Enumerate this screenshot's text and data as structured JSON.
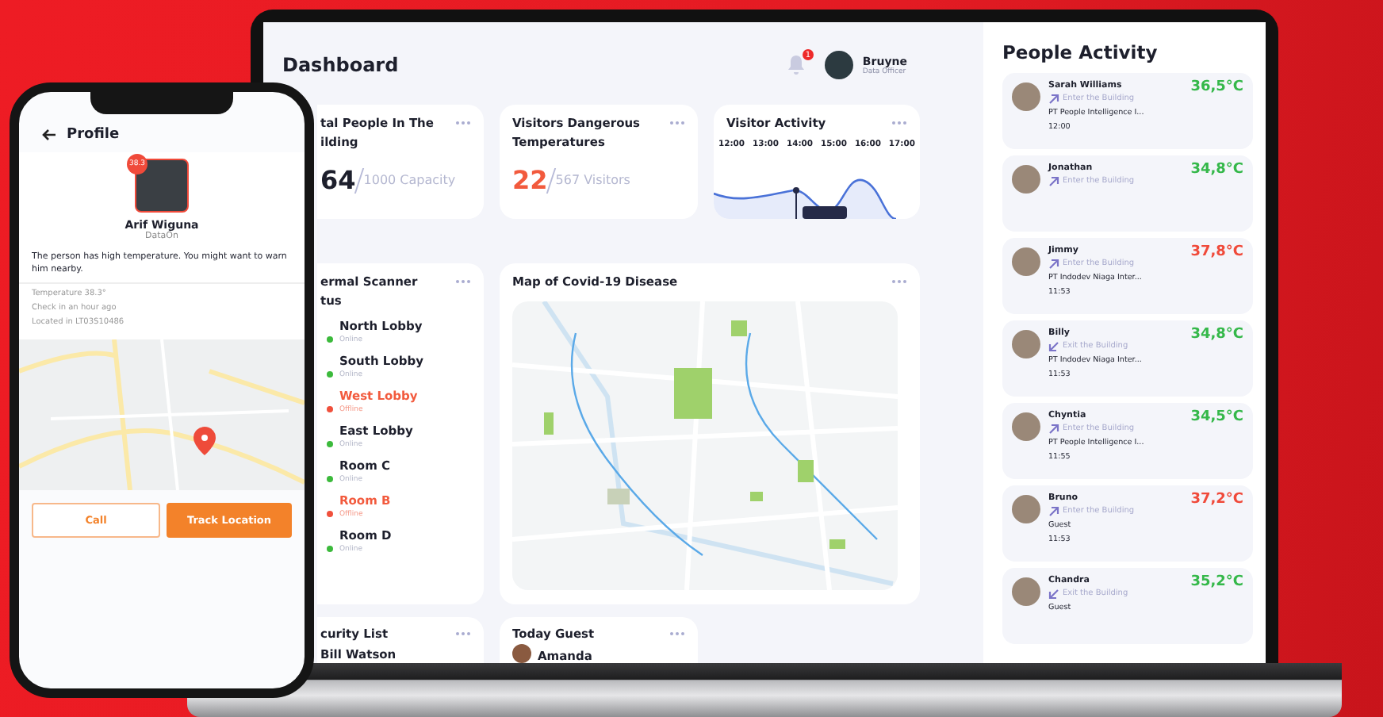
{
  "dashboard": {
    "title": "Dashboard",
    "user": {
      "name": "Bruyne",
      "role": "Data Officer",
      "notifications": "1"
    },
    "stats": [
      {
        "title_lines": [
          "tal People In The",
          "ilding"
        ],
        "value": "64",
        "total": "1000 Capacity",
        "alert": false
      },
      {
        "title_lines": [
          "Visitors Dangerous",
          "Temperatures"
        ],
        "value": "22",
        "total": "567 Visitors",
        "alert": true
      }
    ],
    "visitor_activity": {
      "title": "Visitor Activity",
      "hours": [
        "12:00",
        "13:00",
        "14:00",
        "15:00",
        "16:00",
        "17:00"
      ]
    },
    "scanner": {
      "title_lines": [
        "ermal Scanner",
        "tus"
      ],
      "rooms": [
        {
          "name": "North Lobby",
          "status": "Online",
          "online": true
        },
        {
          "name": "South Lobby",
          "status": "Online",
          "online": true
        },
        {
          "name": "West Lobby",
          "status": "Offline",
          "online": false
        },
        {
          "name": "East Lobby",
          "status": "Online",
          "online": true
        },
        {
          "name": "Room C",
          "status": "Online",
          "online": true
        },
        {
          "name": "Room B",
          "status": "Offline",
          "online": false
        },
        {
          "name": "Room D",
          "status": "Online",
          "online": true
        }
      ]
    },
    "map": {
      "title": "Map of Covid-19 Disease"
    },
    "security": {
      "title": "curity List",
      "first": "Bill Watson"
    },
    "guest": {
      "title": "Today Guest",
      "first": "Amanda"
    }
  },
  "people_activity": {
    "title": "People Activity",
    "people": [
      {
        "name": "Sarah Williams",
        "action": "Enter the Building",
        "kind": "enter",
        "company": "PT People Intelligence I...",
        "time": "12:00",
        "temperature": "36,5°C",
        "hot": false
      },
      {
        "name": "Jonathan",
        "action": "Enter the Building",
        "kind": "enter",
        "temperature": "34,8°C",
        "hot": false
      },
      {
        "name": "Jimmy",
        "action": "Enter the Building",
        "kind": "enter",
        "company": "PT Indodev Niaga Inter...",
        "time": "11:53",
        "temperature": "37,8°C",
        "hot": true
      },
      {
        "name": "Billy",
        "action": "Exit the Building",
        "kind": "exit",
        "company": "PT Indodev Niaga Inter...",
        "time": "11:53",
        "temperature": "34,8°C",
        "hot": false
      },
      {
        "name": "Chyntia",
        "action": "Enter the Building",
        "kind": "enter",
        "company": "PT People Intelligence I...",
        "time": "11:55",
        "temperature": "34,5°C",
        "hot": false
      },
      {
        "name": "Bruno",
        "action": "Enter the Building",
        "kind": "enter",
        "company": "Guest",
        "time": "11:53",
        "temperature": "37,2°C",
        "hot": true
      },
      {
        "name": "Chandra",
        "action": "Exit the Building",
        "kind": "exit",
        "company": "Guest",
        "temperature": "35,2°C",
        "hot": false
      }
    ]
  },
  "phone": {
    "title": "Profile",
    "badge": "38.3",
    "name": "Arif Wiguna",
    "company": "DataOn",
    "message": "The person has high temperature. You might want to warn him nearby.",
    "details": [
      "Temperature 38.3°",
      "Check in an hour ago",
      "Located in LT03S10486"
    ],
    "buttons": [
      {
        "label": "Call",
        "primary": false
      },
      {
        "label": "Track Location",
        "primary": true
      }
    ]
  }
}
